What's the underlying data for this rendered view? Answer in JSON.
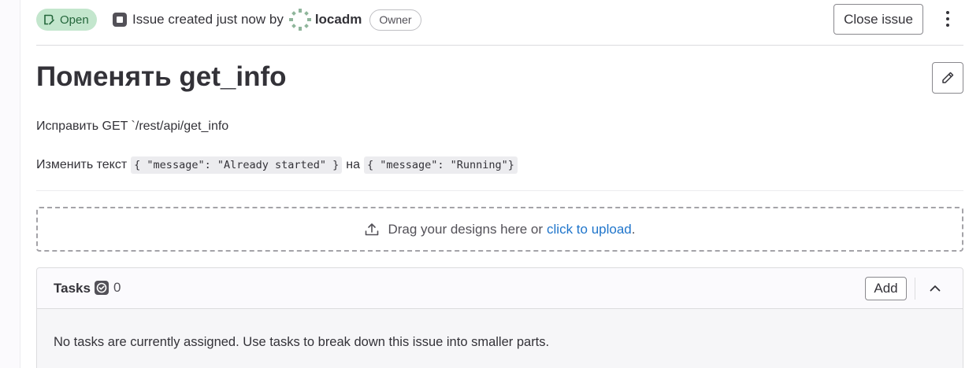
{
  "header": {
    "status": "Open",
    "status_icon": "issue-open-icon",
    "meta_prefix": "Issue created just now by",
    "author": "locadm",
    "role": "Owner",
    "close_label": "Close issue"
  },
  "issue": {
    "title": "Поменять get_info",
    "description": {
      "line1": "Исправить GET `/rest/api/get_info",
      "line2_prefix": "Изменить текст",
      "line2_code1": "{ \"message\": \"Already started\" }",
      "line2_mid": "на",
      "line2_code2": "{ \"message\": \"Running\"}"
    }
  },
  "upload": {
    "prefix": "Drag your designs here or",
    "link": "click to upload",
    "suffix": "."
  },
  "tasks": {
    "title": "Tasks",
    "count": "0",
    "add_label": "Add",
    "empty_text": "No tasks are currently assigned. Use tasks to break down this issue into smaller parts."
  },
  "colors": {
    "status_bg": "#c3e6cd",
    "status_fg": "#24663b",
    "link": "#1f75cb",
    "text": "#333238"
  }
}
